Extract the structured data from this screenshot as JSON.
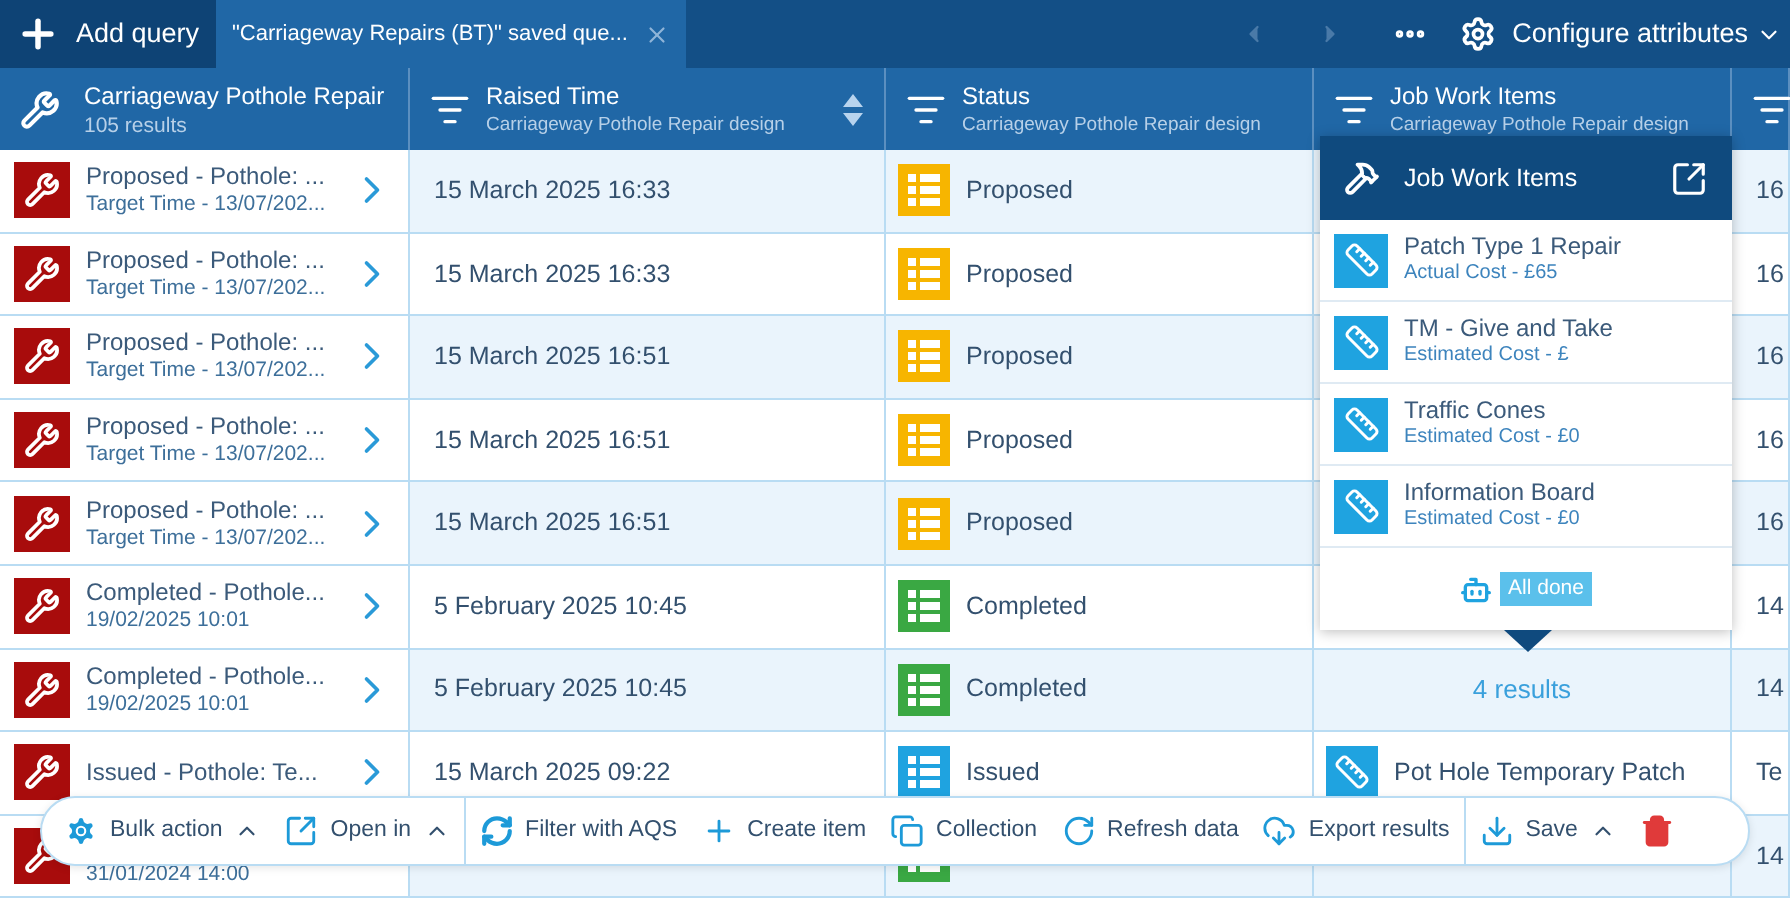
{
  "top_bar": {
    "add_query": "Add query",
    "tabs": [
      {
        "label": "\"Carriageway Repairs (BT)\" saved que...",
        "selected": true
      }
    ],
    "configure": "Configure attributes"
  },
  "columns": [
    {
      "title": "Carriageway Pothole Repair",
      "subtitle": "105 results",
      "kind": "main"
    },
    {
      "title": "Raised Time",
      "subtitle": "Carriageway Pothole Repair design",
      "kind": "field",
      "sortable": true
    },
    {
      "title": "Status",
      "subtitle": "Carriageway Pothole Repair design",
      "kind": "field",
      "sortable": false
    },
    {
      "title": "Job Work Items",
      "subtitle": "Carriageway Pothole Repair design",
      "kind": "field",
      "sortable": false
    },
    {
      "kind": "cut"
    }
  ],
  "rows": [
    {
      "title": "Proposed - Pothole: ...",
      "subtitle": "Target Time - 13/07/202...",
      "raised": "15 March 2025 16:33",
      "status": {
        "label": "Proposed",
        "color": "#f7b500"
      },
      "work": {
        "kind": "hidden"
      },
      "column_5": "16"
    },
    {
      "title": "Proposed - Pothole: ...",
      "subtitle": "Target Time - 13/07/202...",
      "raised": "15 March 2025 16:33",
      "status": {
        "label": "Proposed",
        "color": "#f7b500"
      },
      "work": {
        "kind": "hidden"
      },
      "column_5": "16"
    },
    {
      "title": "Proposed - Pothole: ...",
      "subtitle": "Target Time - 13/07/202...",
      "raised": "15 March 2025 16:51",
      "status": {
        "label": "Proposed",
        "color": "#f7b500"
      },
      "work": {
        "kind": "hidden"
      },
      "column_5": "16"
    },
    {
      "title": "Proposed - Pothole: ...",
      "subtitle": "Target Time - 13/07/202...",
      "raised": "15 March 2025 16:51",
      "status": {
        "label": "Proposed",
        "color": "#f7b500"
      },
      "work": {
        "kind": "hidden"
      },
      "column_5": "16"
    },
    {
      "title": "Proposed - Pothole: ...",
      "subtitle": "Target Time - 13/07/202...",
      "raised": "15 March 2025 16:51",
      "status": {
        "label": "Proposed",
        "color": "#f7b500"
      },
      "work": {
        "kind": "hidden"
      },
      "column_5": "16"
    },
    {
      "title": "Completed - Pothole...",
      "subtitle": "19/02/2025 10:01",
      "raised": "5 February 2025 10:45",
      "status": {
        "label": "Completed",
        "color": "#3aa843"
      },
      "work": {
        "kind": "hidden"
      },
      "column_5": "14"
    },
    {
      "title": "Completed - Pothole...",
      "subtitle": "19/02/2025 10:01",
      "raised": "5 February 2025 10:45",
      "status": {
        "label": "Completed",
        "color": "#3aa843"
      },
      "work": {
        "kind": "count",
        "text": "4 results"
      },
      "column_5": "14"
    },
    {
      "title": "Issued - Pothole: Te...",
      "raised": "15 March 2025 09:22",
      "status": {
        "label": "Issued",
        "color": "#1fa3e0"
      },
      "work": {
        "kind": "item",
        "text": "Pot Hole Temporary Patch"
      },
      "column_5": "Te"
    },
    {
      "subtitle": "31/01/2024 14:00",
      "status": {
        "color": "#3aa843"
      },
      "work": {
        "kind": "empty"
      },
      "column_5": "14"
    }
  ],
  "popup": {
    "title": "Job Work Items",
    "items": [
      {
        "title": "Patch Type 1 Repair",
        "subtitle": "Actual Cost - £65"
      },
      {
        "title": "TM - Give and Take",
        "subtitle": "Estimated Cost - £"
      },
      {
        "title": "Traffic Cones",
        "subtitle": "Estimated Cost - £0"
      },
      {
        "title": "Information Board",
        "subtitle": "Estimated Cost - £0"
      }
    ],
    "status": "All done"
  },
  "actions": [
    [
      {
        "kind": "bulk",
        "label": "Bulk action",
        "menu": true
      },
      {
        "kind": "open",
        "label": "Open in",
        "menu": true
      }
    ],
    [
      {
        "kind": "filter",
        "label": "Filter with AQS",
        "menu": false
      },
      {
        "kind": "create",
        "label": "Create item",
        "menu": false
      },
      {
        "kind": "collection",
        "label": "Collection",
        "menu": false
      },
      {
        "kind": "refresh",
        "label": "Refresh data",
        "menu": false
      },
      {
        "kind": "export",
        "label": "Export results",
        "menu": false
      }
    ],
    [
      {
        "kind": "save",
        "label": "Save",
        "menu": true
      },
      {
        "kind": "delete",
        "menu": false
      }
    ]
  ]
}
